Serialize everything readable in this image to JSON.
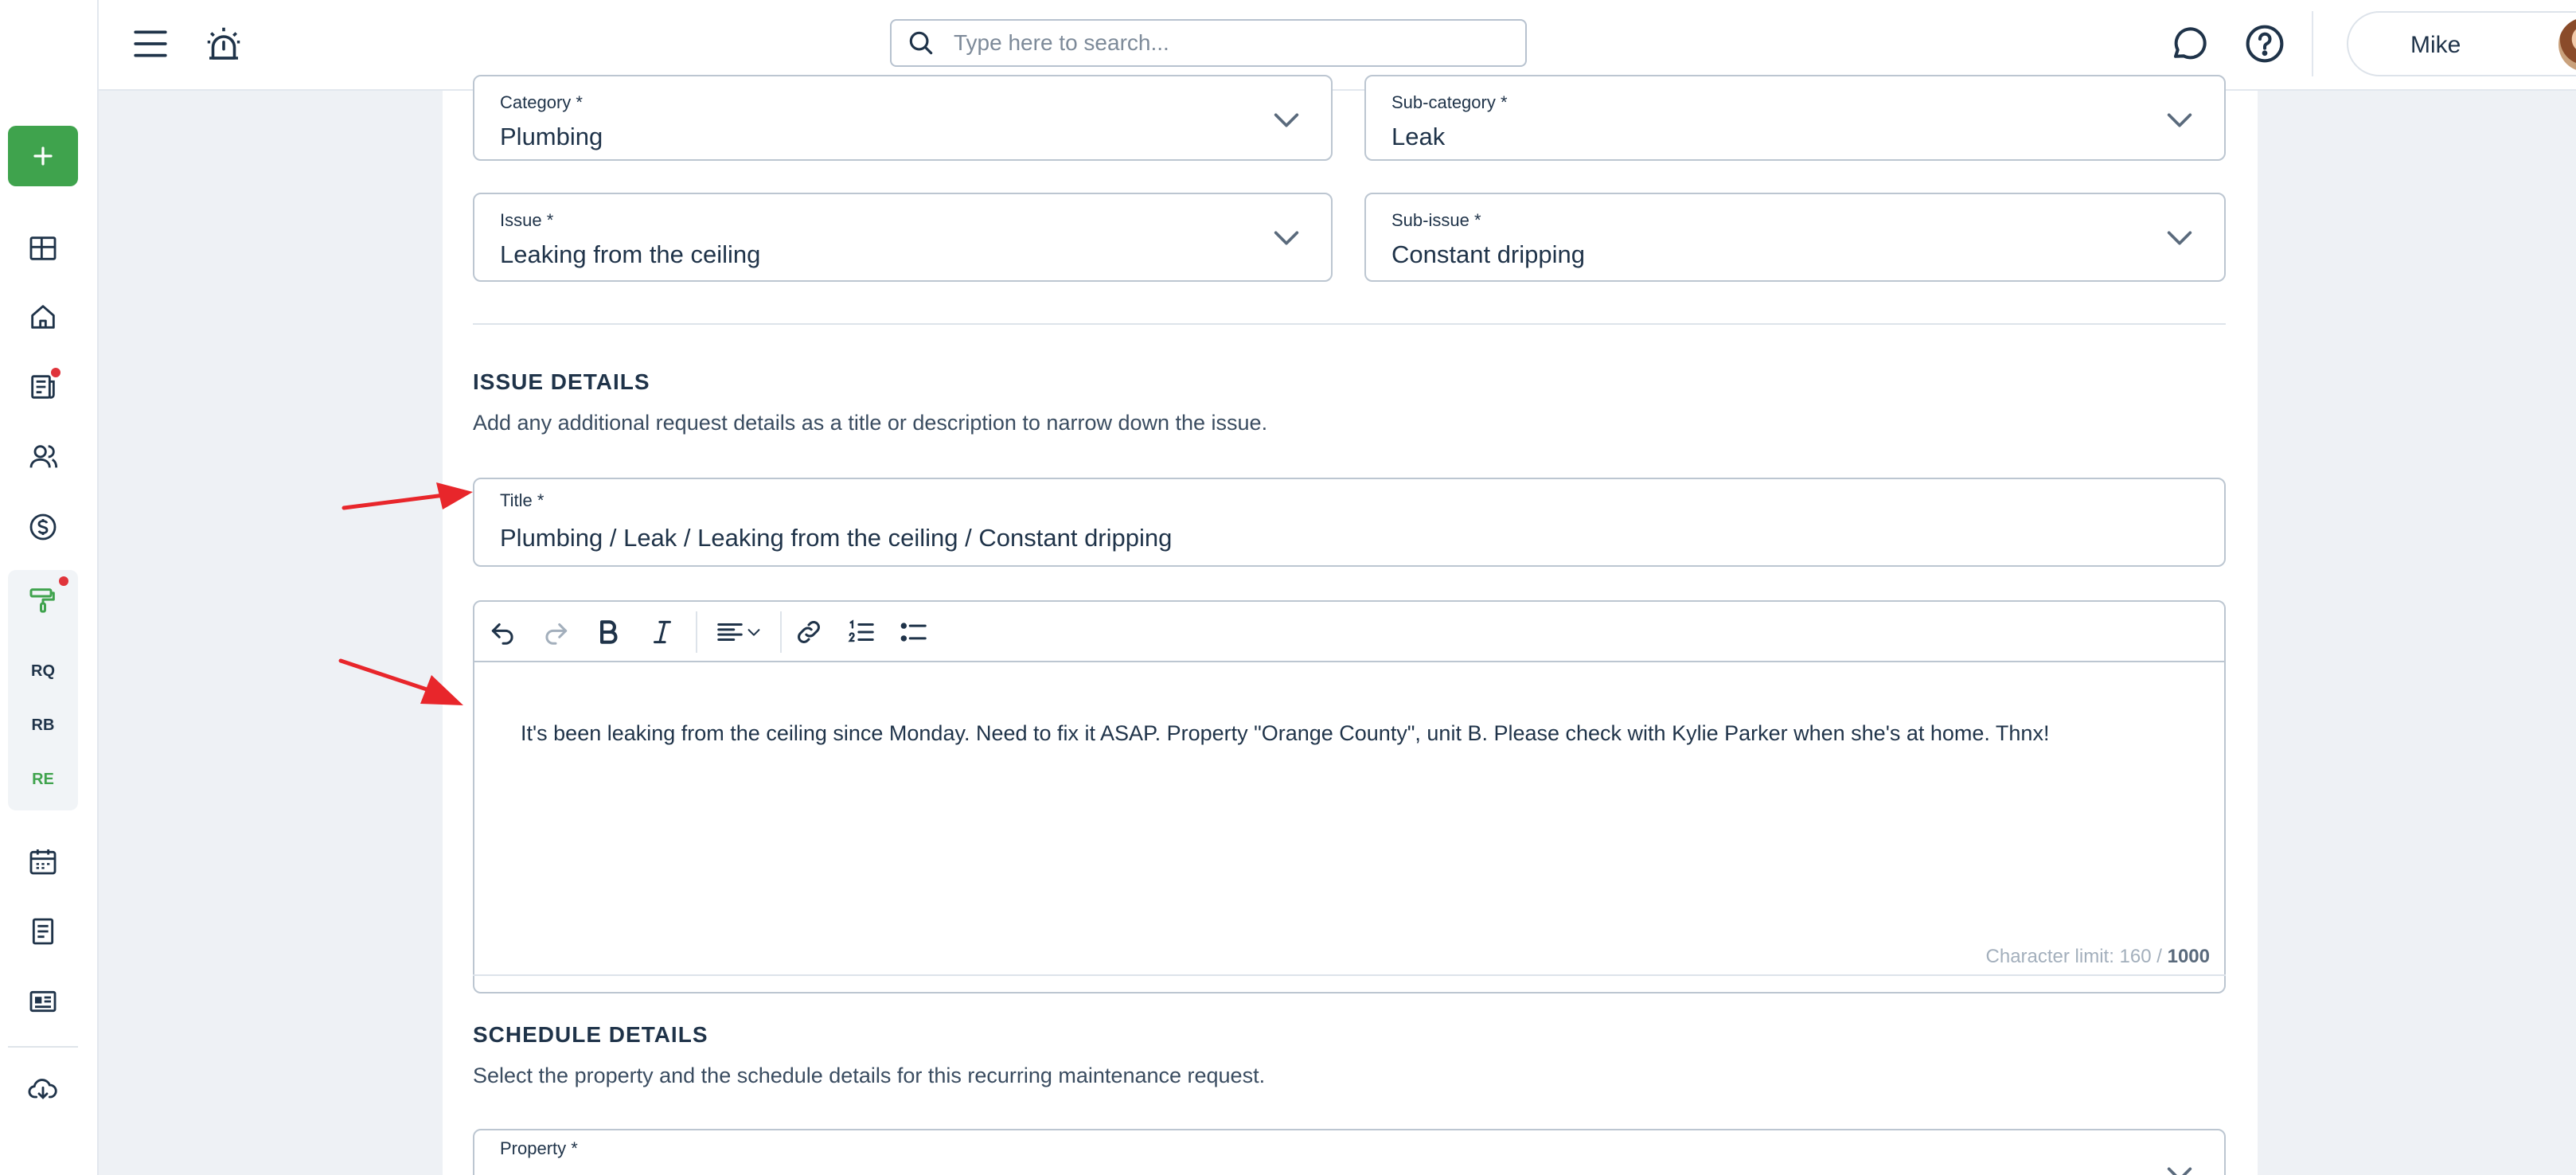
{
  "search": {
    "placeholder": "Type here to search..."
  },
  "user": {
    "name": "Mike"
  },
  "sidebar": {
    "sub_items": [
      {
        "label": "RQ"
      },
      {
        "label": "RB"
      },
      {
        "label": "RE"
      }
    ]
  },
  "form": {
    "category": {
      "label": "Category *",
      "value": "Plumbing"
    },
    "subcategory": {
      "label": "Sub-category *",
      "value": "Leak"
    },
    "issue": {
      "label": "Issue *",
      "value": "Leaking from the ceiling"
    },
    "subissue": {
      "label": "Sub-issue *",
      "value": "Constant dripping"
    },
    "issue_details": {
      "title": "ISSUE DETAILS",
      "description": "Add any additional request details as a title or description to narrow down the issue.",
      "title_field": {
        "label": "Title *",
        "value": "Plumbing / Leak / Leaking from the ceiling / Constant dripping"
      },
      "body": "It's been leaking from the ceiling since Monday. Need to fix it ASAP. Property \"Orange County\", unit B. Please check with Kylie Parker when she's at home. Thnx!",
      "char_limit_label": "Character limit: 160 / ",
      "char_limit_max": "1000"
    },
    "schedule_details": {
      "title": "SCHEDULE DETAILS",
      "description": "Select the property and the schedule details for this recurring maintenance request.",
      "property_label": "Property *"
    }
  },
  "colors": {
    "accent": "#3fa34d",
    "alert": "#e0343b",
    "annotation_arrow": "#e8262b"
  }
}
